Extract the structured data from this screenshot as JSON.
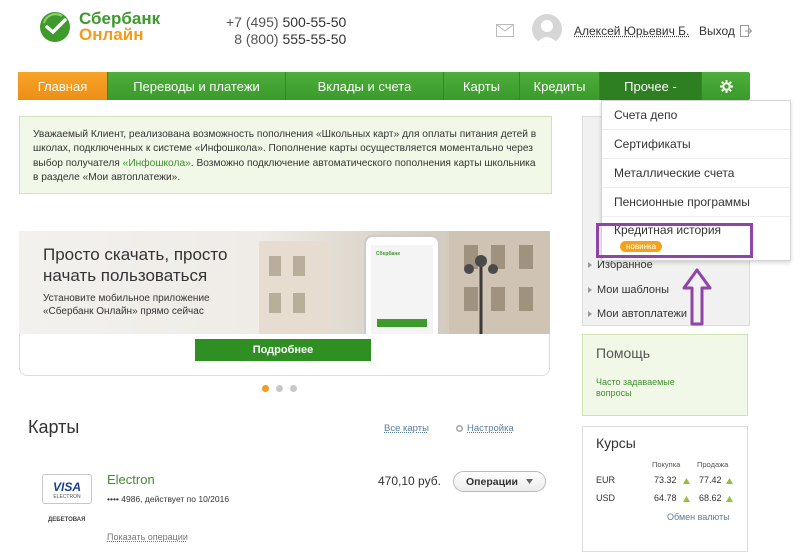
{
  "header": {
    "logo_line1": "Сбербанк",
    "logo_line2": "Онлайн",
    "phone1_code": "+7 (495)",
    "phone1_num": "500-55-50",
    "phone2_code": "8 (800)",
    "phone2_num": "555-55-50",
    "user_name": "Алексей Юрьевич Б.",
    "logout_label": "Выход"
  },
  "nav": {
    "items": [
      {
        "label": "Главная"
      },
      {
        "label": "Переводы и платежи"
      },
      {
        "label": "Вклады и счета"
      },
      {
        "label": "Карты"
      },
      {
        "label": "Кредиты"
      },
      {
        "label": "Прочее -"
      }
    ]
  },
  "dropdown": {
    "items": [
      {
        "label": "Счета депо"
      },
      {
        "label": "Сертификаты"
      },
      {
        "label": "Металлические счета"
      },
      {
        "label": "Пенсионные программы"
      },
      {
        "label": "Кредитная история"
      }
    ],
    "badge": "новинка"
  },
  "notice": {
    "text_before": "Уважаемый Клиент, реализована возможность пополнения «Школьных карт» для оплаты питания детей в школах, подключенных к системе «Инфошкола». Пополнение карты осуществляется моментально через выбор получателя ",
    "link": "«Инфошкола»",
    "text_after": ". Возможно подключение автоматического пополнения карты школьника в разделе «Мои автоплатежи»."
  },
  "banner": {
    "title_line1": "Просто скачать, просто",
    "title_line2": "начать пользоваться",
    "sub_line1": "Установите мобильное приложение",
    "sub_line2": "«Сбербанк Онлайн» прямо сейчас",
    "phone_logo": "Сбербанк",
    "button": "Подробнее",
    "active_slide": 1,
    "slide_count": 3
  },
  "cards": {
    "title": "Карты",
    "all_link": "Все карты",
    "settings_link": "Настройка",
    "card": {
      "brand": "VISA",
      "brand_sub": "ELECTRON",
      "type_label": "ДЕБЕТОВАЯ",
      "name": "Electron",
      "number": "•••• 4986, действует по 10/2016",
      "amount": "470,10 руб.",
      "ops_button": "Операции",
      "show_ops": "Показать операции"
    }
  },
  "right": {
    "menu": [
      {
        "label": "Избранное"
      },
      {
        "label": "Мои шаблоны"
      },
      {
        "label": "Мои автоплатежи"
      }
    ],
    "help_title": "Помощь",
    "help_link_line1": "Часто задаваемые",
    "help_link_line2": "вопросы",
    "rates_title": "Курсы",
    "buy_label": "Покупка",
    "sell_label": "Продажа",
    "rates": [
      {
        "cur": "EUR",
        "buy": "73.32",
        "sell": "77.42"
      },
      {
        "cur": "USD",
        "buy": "64.78",
        "sell": "68.62"
      }
    ],
    "exchange_link": "Обмен валюты"
  },
  "colors": {
    "brand_green": "#3f9a2e",
    "brand_orange": "#f29b1d",
    "highlight_purple": "#8e44a8"
  }
}
